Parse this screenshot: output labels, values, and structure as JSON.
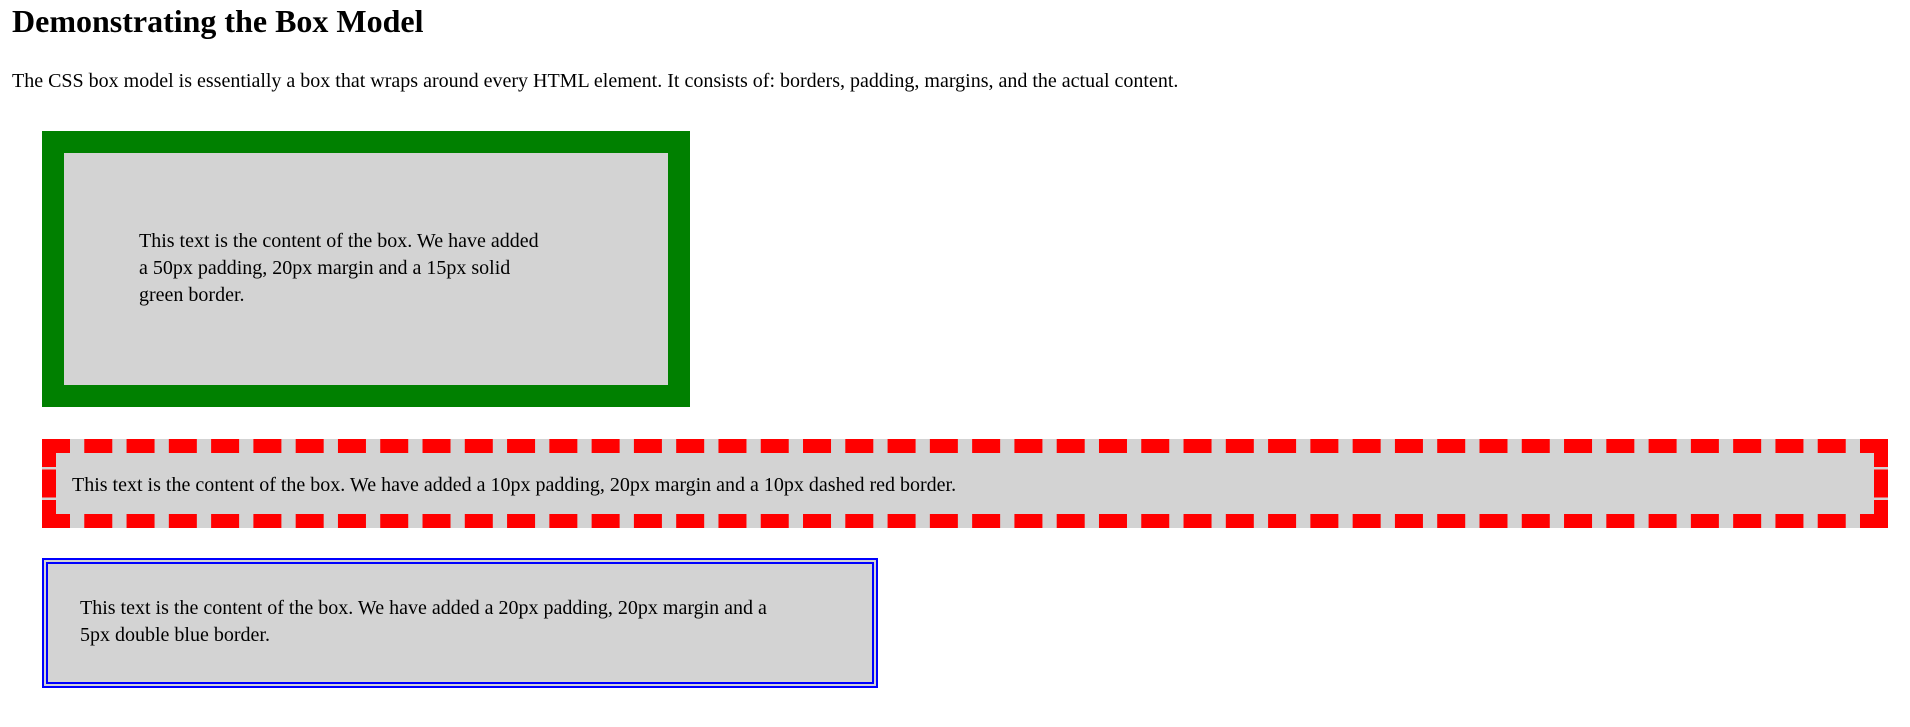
{
  "page": {
    "heading": "Demonstrating the Box Model",
    "intro": "The CSS box model is essentially a box that wraps around every HTML element. It consists of: borders, padding, margins, and the actual content."
  },
  "boxes": [
    {
      "text": "This text is the content of the box. We have added a 50px padding, 20px margin and a 15px solid green border.",
      "background": "#d3d3d3",
      "border_color": "#008000",
      "border_style": "solid"
    },
    {
      "text": "This text is the content of the box. We have added a 10px padding, 20px margin and a 10px dashed red border.",
      "background": "#d3d3d3",
      "border_color": "#ff0000",
      "border_style": "dashed"
    },
    {
      "text": "This text is the content of the box. We have added a 20px padding, 20px margin and a 5px double blue border.",
      "background": "#d3d3d3",
      "border_color": "#0000ff",
      "border_style": "double"
    }
  ]
}
